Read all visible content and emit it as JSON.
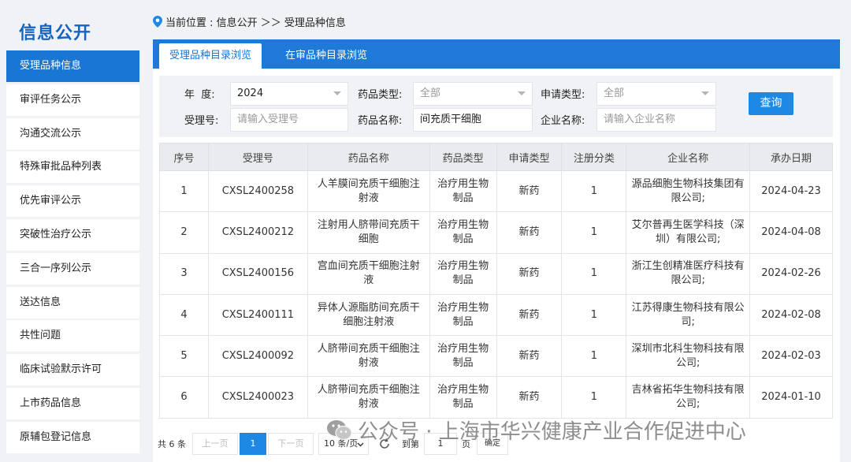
{
  "sidebar": {
    "title": "信息公开",
    "items": [
      {
        "label": "受理品种信息"
      },
      {
        "label": "审评任务公示"
      },
      {
        "label": "沟通交流公示"
      },
      {
        "label": "特殊审批品种列表"
      },
      {
        "label": "优先审评公示"
      },
      {
        "label": "突破性治疗公示"
      },
      {
        "label": "三合一序列公示"
      },
      {
        "label": "送达信息"
      },
      {
        "label": "共性问题"
      },
      {
        "label": "临床试验默示许可"
      },
      {
        "label": "上市药品信息"
      },
      {
        "label": "原辅包登记信息"
      }
    ]
  },
  "breadcrumb": {
    "text": "当前位置 : 信息公开 ＞＞ 受理品种信息"
  },
  "tabs": [
    {
      "label": "受理品种目录浏览"
    },
    {
      "label": "在审品种目录浏览"
    }
  ],
  "filter": {
    "year_label": "年  度:",
    "year_value": "2024",
    "drug_type_label": "药品类型:",
    "drug_type_value": "全部",
    "apply_type_label": "申请类型:",
    "apply_type_value": "全部",
    "accept_no_label": "受理号:",
    "accept_no_placeholder": "请输入受理号",
    "drug_name_label": "药品名称:",
    "drug_name_value": "间充质干细胞",
    "company_label": "企业名称:",
    "company_placeholder": "请输入企业名称",
    "query_label": "查询"
  },
  "table": {
    "headers": [
      "序号",
      "受理号",
      "药品名称",
      "药品类型",
      "申请类型",
      "注册分类",
      "企业名称",
      "承办日期"
    ],
    "rows": [
      [
        "1",
        "CXSL2400258",
        "人羊膜间充质干细胞注射液",
        "治疗用生物制品",
        "新药",
        "1",
        "源品细胞生物科技集团有限公司;",
        "2024-04-23"
      ],
      [
        "2",
        "CXSL2400212",
        "注射用人脐带间充质干细胞",
        "治疗用生物制品",
        "新药",
        "1",
        "艾尔普再生医学科技（深圳）有限公司;",
        "2024-04-08"
      ],
      [
        "3",
        "CXSL2400156",
        "宫血间充质干细胞注射液",
        "治疗用生物制品",
        "新药",
        "1",
        "浙江生创精准医疗科技有限公司;",
        "2024-02-26"
      ],
      [
        "4",
        "CXSL2400111",
        "异体人源脂肪间充质干细胞注射液",
        "治疗用生物制品",
        "新药",
        "1",
        "江苏得康生物科技有限公司;",
        "2024-02-08"
      ],
      [
        "5",
        "CXSL2400092",
        "人脐带间充质干细胞注射液",
        "治疗用生物制品",
        "新药",
        "1",
        "深圳市北科生物科技有限公司;",
        "2024-02-03"
      ],
      [
        "6",
        "CXSL2400023",
        "人脐带间充质干细胞注射液",
        "治疗用生物制品",
        "新药",
        "1",
        "吉林省拓华生物科技有限公司;",
        "2024-01-10"
      ]
    ]
  },
  "pager": {
    "total": "共 6 条",
    "prev": "上一页",
    "current": "1",
    "next": "下一页",
    "page_size": "10 条/页",
    "goto_prefix": "到第",
    "goto_value": "1",
    "goto_suffix": "页",
    "confirm": "确定"
  },
  "watermark": {
    "text": "公众号 · 上海市华兴健康产业合作促进中心"
  },
  "colors": {
    "primary": "#1976d2",
    "tabbar": "#1e7ad6",
    "button": "#1e88e5"
  }
}
